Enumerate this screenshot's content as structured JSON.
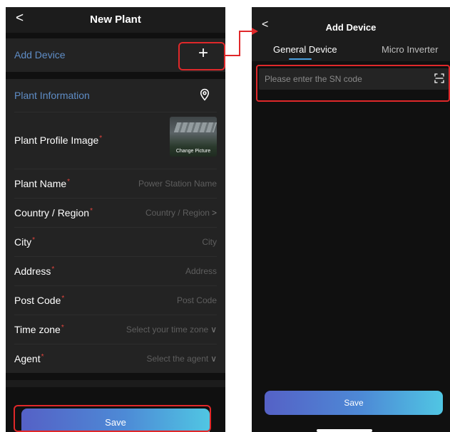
{
  "left_screen": {
    "header": {
      "back_icon": "chevron-left-icon",
      "back_glyph": "<",
      "title": "New Plant"
    },
    "add_device": {
      "label": "Add Device",
      "icon": "plus-icon",
      "glyph": "+"
    },
    "plant_information": {
      "section_title": "Plant Information",
      "location_icon": "location-pin-icon",
      "required_mark": "*",
      "profile_image": {
        "label": "Plant Profile Image",
        "caption": "Change Picture"
      },
      "fields": [
        {
          "label": "Plant Name",
          "placeholder": "Power Station Name",
          "chevron": ""
        },
        {
          "label": "Country / Region",
          "placeholder": "Country / Region",
          "chevron": ">"
        },
        {
          "label": "City",
          "placeholder": "City",
          "chevron": ""
        },
        {
          "label": "Address",
          "placeholder": "Address",
          "chevron": ""
        },
        {
          "label": "Post Code",
          "placeholder": "Post Code",
          "chevron": ""
        },
        {
          "label": "Time zone",
          "placeholder": "Select your time zone",
          "chevron": "∨"
        },
        {
          "label": "Agent",
          "placeholder": "Select the agent",
          "chevron": "∨"
        }
      ]
    },
    "save_label": "Save"
  },
  "right_screen": {
    "header": {
      "back_icon": "chevron-left-icon",
      "back_glyph": "<",
      "title": "Add Device"
    },
    "tabs": [
      {
        "label": "General Device",
        "active": true
      },
      {
        "label": "Micro Inverter",
        "active": false
      }
    ],
    "sn_input": {
      "value": "",
      "placeholder": "Please enter the SN code",
      "scan_icon": "scan-icon"
    },
    "save_label": "Save"
  },
  "colors": {
    "accent_blue": "#5f8dc6",
    "required_red": "#e0443d",
    "highlight_red": "#e0282a",
    "tab_indicator": "#4aa0e0",
    "button_gradient_start": "#5561c6",
    "button_gradient_end": "#50c6e3",
    "background": "#101010",
    "card": "#232323"
  }
}
